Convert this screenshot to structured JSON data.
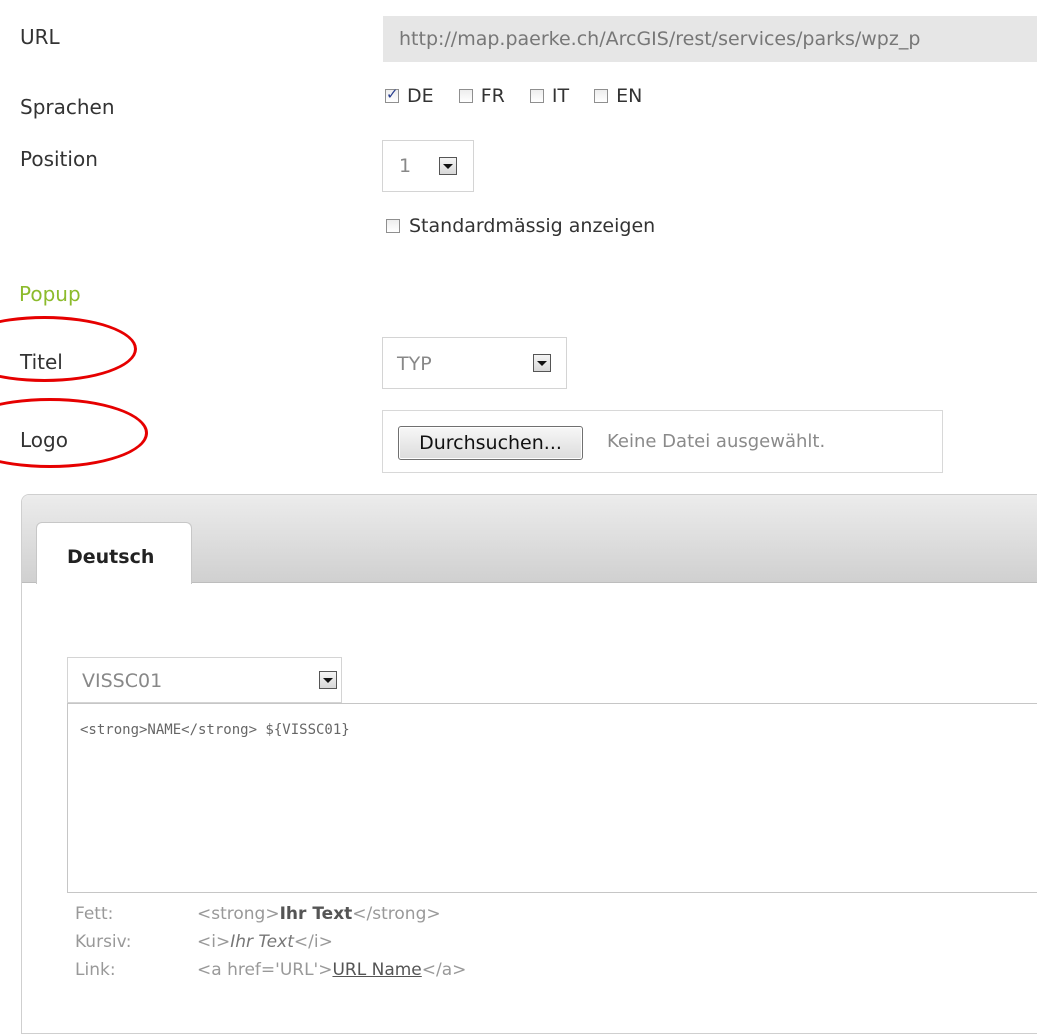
{
  "form": {
    "url": {
      "label": "URL",
      "value": "http://map.paerke.ch/ArcGIS/rest/services/parks/wpz_p"
    },
    "languages": {
      "label": "Sprachen",
      "options": [
        {
          "code": "DE",
          "checked": true
        },
        {
          "code": "FR",
          "checked": false
        },
        {
          "code": "IT",
          "checked": false
        },
        {
          "code": "EN",
          "checked": false
        }
      ]
    },
    "position": {
      "label": "Position",
      "value": "1"
    },
    "default_display": {
      "label": "Standardmässig anzeigen",
      "checked": false
    }
  },
  "popup": {
    "section_title": "Popup",
    "title": {
      "label": "Titel",
      "value": "TYP"
    },
    "logo": {
      "label": "Logo",
      "button_label": "Durchsuchen...",
      "no_file_text": "Keine Datei ausgewählt."
    }
  },
  "tabs": [
    {
      "label": "Deutsch",
      "active": true
    }
  ],
  "content": {
    "field_select": "VISSC01",
    "template_text": "<strong>NAME</strong> ${VISSC01}",
    "help": {
      "bold": {
        "label": "Fett:",
        "prefix": "<strong>",
        "sample": "Ihr Text",
        "suffix": "</strong>"
      },
      "italic": {
        "label": "Kursiv:",
        "prefix": "<i>",
        "sample": "Ihr Text",
        "suffix": "</i>"
      },
      "link": {
        "label": "Link:",
        "prefix": "<a href='URL'>",
        "sample": "URL Name",
        "suffix": "</a>"
      }
    }
  },
  "colors": {
    "section_title": "#8cbb2c",
    "annotation_circle": "#e60000",
    "checkbox_check": "#2a3f8f"
  }
}
